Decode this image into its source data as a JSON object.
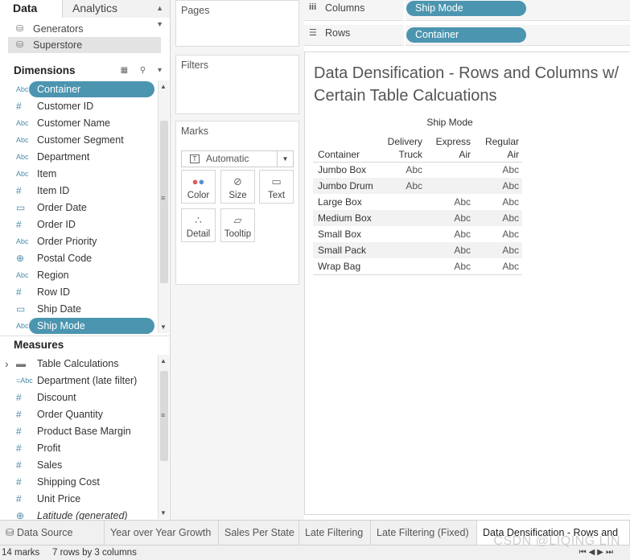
{
  "data_pane": {
    "tab_data": "Data",
    "tab_analytics": "Analytics",
    "datasources": [
      {
        "label": "Generators",
        "selected": false
      },
      {
        "label": "Superstore",
        "selected": true
      }
    ],
    "dimensions_header": "Dimensions",
    "dimensions": [
      {
        "type": "Abc",
        "label": "Container",
        "pill": true
      },
      {
        "type": "#",
        "label": "Customer ID"
      },
      {
        "type": "Abc",
        "label": "Customer Name"
      },
      {
        "type": "Abc",
        "label": "Customer Segment"
      },
      {
        "type": "Abc",
        "label": "Department"
      },
      {
        "type": "Abc",
        "label": "Item"
      },
      {
        "type": "#",
        "label": "Item ID"
      },
      {
        "type": "cal",
        "label": "Order Date"
      },
      {
        "type": "#",
        "label": "Order ID"
      },
      {
        "type": "Abc",
        "label": "Order Priority"
      },
      {
        "type": "globe",
        "label": "Postal Code"
      },
      {
        "type": "Abc",
        "label": "Region"
      },
      {
        "type": "#",
        "label": "Row ID"
      },
      {
        "type": "cal",
        "label": "Ship Date"
      },
      {
        "type": "Abc",
        "label": "Ship Mode",
        "pill": true
      }
    ],
    "measures_header": "Measures",
    "measures": [
      {
        "type": "folder",
        "label": "Table Calculations"
      },
      {
        "type": "=Abc",
        "label": "Department (late filter)"
      },
      {
        "type": "#",
        "label": "Discount"
      },
      {
        "type": "#",
        "label": "Order Quantity"
      },
      {
        "type": "#",
        "label": "Product Base Margin"
      },
      {
        "type": "#",
        "label": "Profit"
      },
      {
        "type": "#",
        "label": "Sales"
      },
      {
        "type": "#",
        "label": "Shipping Cost"
      },
      {
        "type": "#",
        "label": "Unit Price"
      },
      {
        "type": "globe",
        "label": "Latitude (generated)",
        "italic": true
      }
    ]
  },
  "cards": {
    "pages": "Pages",
    "filters": "Filters",
    "marks": "Marks",
    "mark_type": "Automatic",
    "mark_buttons": [
      {
        "label": "Color",
        "icon": "color-dots-icon"
      },
      {
        "label": "Size",
        "icon": "size-icon"
      },
      {
        "label": "Text",
        "icon": "text-icon"
      },
      {
        "label": "Detail",
        "icon": "detail-icon"
      },
      {
        "label": "Tooltip",
        "icon": "tooltip-icon"
      }
    ]
  },
  "shelves": {
    "columns_label": "Columns",
    "columns_pill": "Ship Mode",
    "rows_label": "Rows",
    "rows_pill": "Container"
  },
  "view": {
    "title_line1": "Data Densification - Rows and Columns w/",
    "title_line2": "Certain Table Calcuations",
    "column_group_header": "Ship Mode",
    "row_header": "Container",
    "columns": [
      {
        "l1": "Delivery",
        "l2": "Truck"
      },
      {
        "l1": "Express",
        "l2": "Air"
      },
      {
        "l1": "Regular",
        "l2": "Air"
      }
    ],
    "rows": [
      {
        "label": "Jumbo Box",
        "cells": [
          "Abc",
          "",
          "Abc"
        ]
      },
      {
        "label": "Jumbo Drum",
        "cells": [
          "Abc",
          "",
          "Abc"
        ]
      },
      {
        "label": "Large Box",
        "cells": [
          "",
          "Abc",
          "Abc"
        ]
      },
      {
        "label": "Medium Box",
        "cells": [
          "",
          "Abc",
          "Abc"
        ]
      },
      {
        "label": "Small Box",
        "cells": [
          "",
          "Abc",
          "Abc"
        ]
      },
      {
        "label": "Small Pack",
        "cells": [
          "",
          "Abc",
          "Abc"
        ]
      },
      {
        "label": "Wrap Bag",
        "cells": [
          "",
          "Abc",
          "Abc"
        ]
      }
    ]
  },
  "sheet_tabs": [
    {
      "label": "Data Source",
      "icon": "database-icon"
    },
    {
      "label": "Year over Year Growth"
    },
    {
      "label": "Sales Per State"
    },
    {
      "label": "Late Filtering"
    },
    {
      "label": "Late Filtering (Fixed)"
    },
    {
      "label": "Data Densification - Rows and",
      "active": true
    }
  ],
  "status": {
    "marks": "14 marks",
    "dims": "7 rows by 3 columns"
  },
  "watermark": "CSDN @LIQING LIN",
  "colors": {
    "pill": "#4c95b0",
    "type_icon": "#4b8daa"
  }
}
